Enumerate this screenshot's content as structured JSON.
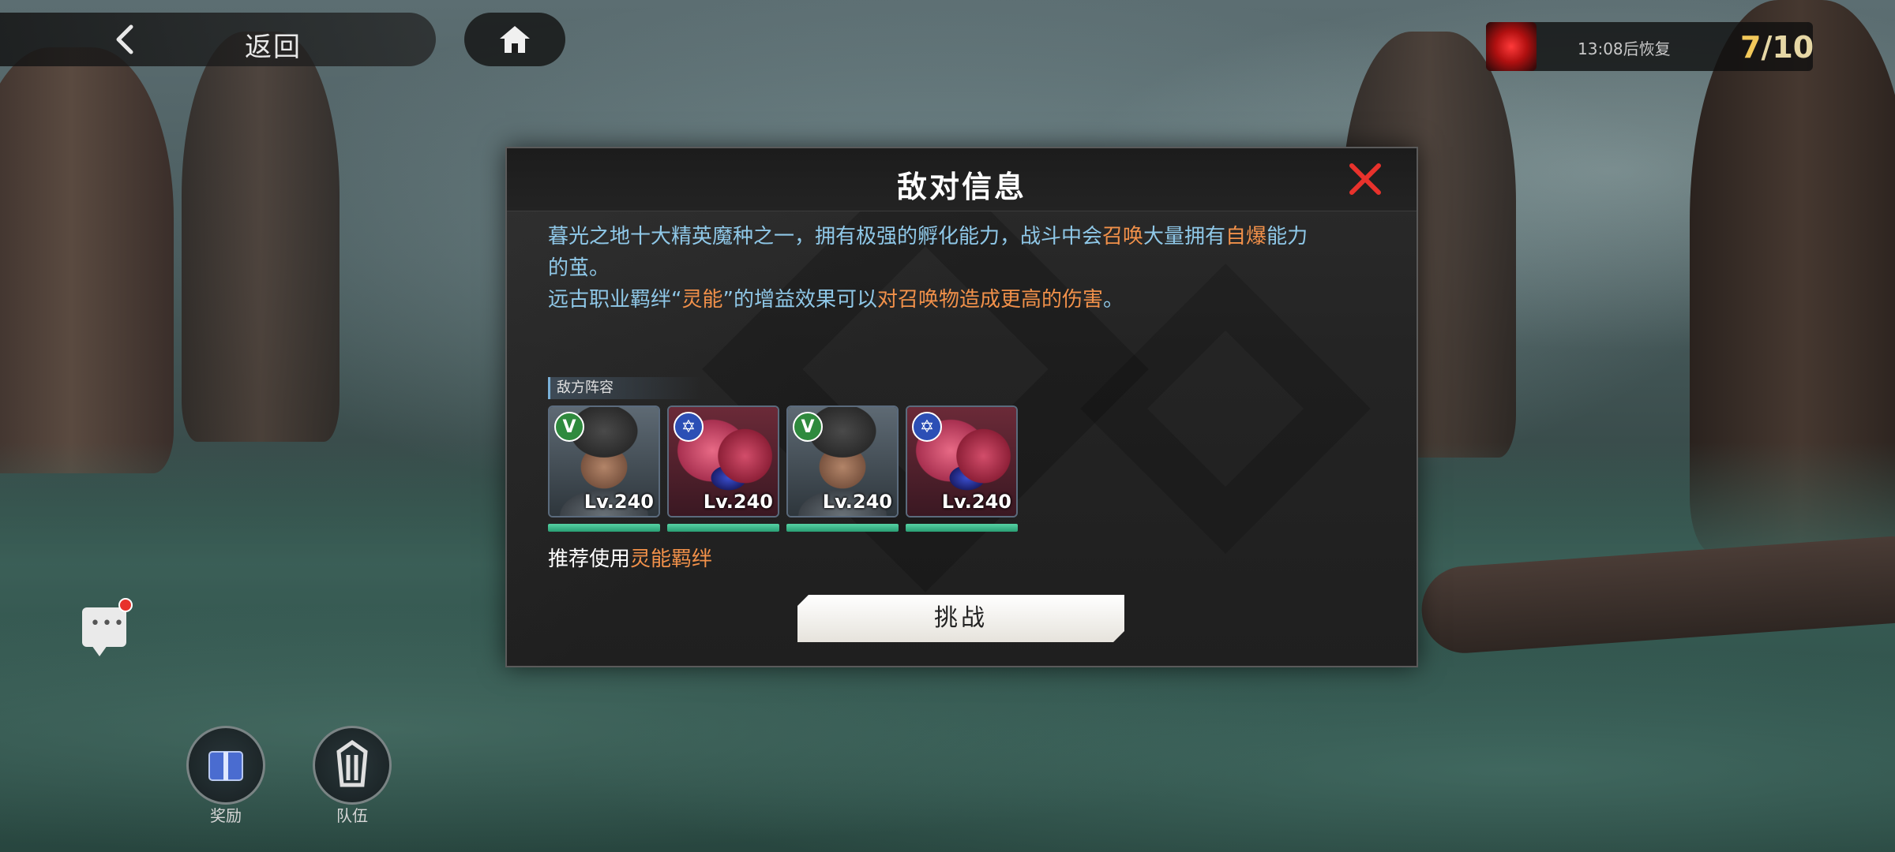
{
  "topbar": {
    "back_label": "返回",
    "resource": {
      "name": "13:08后恢复",
      "count_current": "7",
      "count_total": "/10"
    }
  },
  "dialog": {
    "title": "敌对信息",
    "desc_line1_a": "暮光之地十大精英魔种之一，拥有极强的孵化能力，战斗中会",
    "desc_line1_b": "召唤",
    "desc_line1_c": "大量拥有",
    "desc_line1_d": "自爆",
    "desc_line1_e": "能力",
    "desc_line2": "的茧。",
    "desc_line3_a": "远古职业羁绊“",
    "desc_line3_b": "灵能",
    "desc_line3_c": "”的增益效果可以",
    "desc_line3_d": "对召唤物造成更高的伤害",
    "desc_line3_e": "。",
    "lineup_label": "敌方阵容",
    "enemies": [
      {
        "level": "Lv.240",
        "badge": "V",
        "type": "warrior",
        "hp": 1.0
      },
      {
        "level": "Lv.240",
        "badge": "✡",
        "type": "beast",
        "hp": 1.0
      },
      {
        "level": "Lv.240",
        "badge": "V",
        "type": "warrior",
        "hp": 1.0
      },
      {
        "level": "Lv.240",
        "badge": "✡",
        "type": "beast",
        "hp": 1.0
      }
    ],
    "recommend_prefix": "推荐使用",
    "recommend_bond": "灵能羁绊",
    "challenge_label": "挑战"
  },
  "side": {
    "reward_label": "奖励",
    "team_label": "队伍"
  },
  "colors": {
    "accent_blue": "#8fc8e8",
    "accent_orange": "#f2914a",
    "hp_green": "#3cc08c",
    "close_red": "#e8322c"
  }
}
